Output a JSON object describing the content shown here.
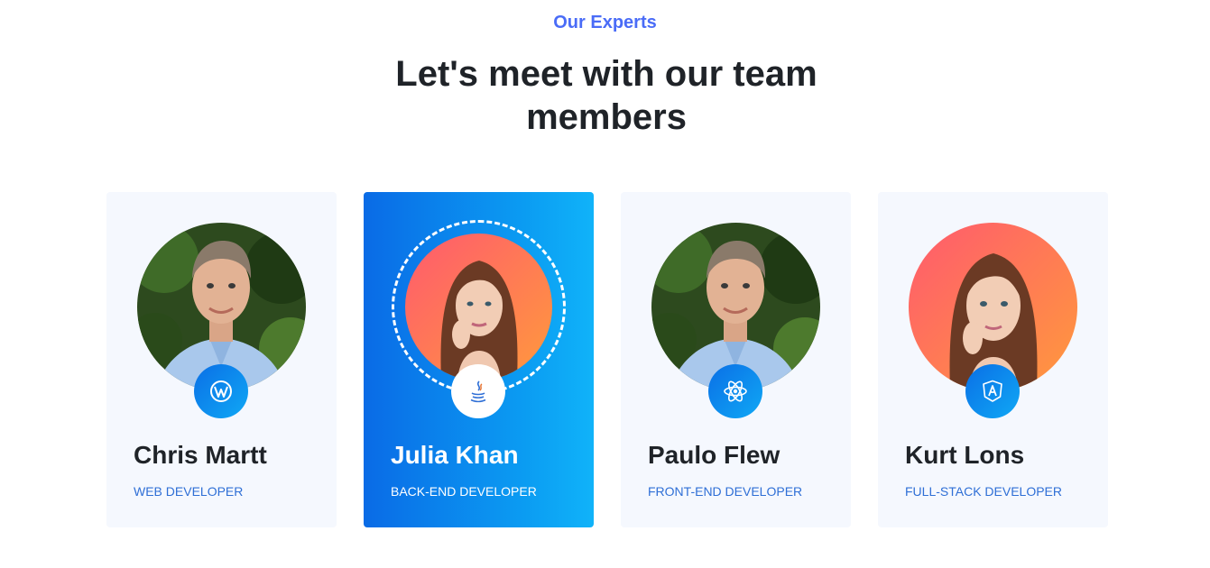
{
  "section": {
    "eyebrow": "Our Experts",
    "title": "Let's meet with our team members"
  },
  "members": [
    {
      "name": "Chris Martt",
      "role": "WEB DEVELOPER",
      "icon": "wordpress-icon",
      "active": false
    },
    {
      "name": "Julia Khan",
      "role": "BACK-END DEVELOPER",
      "icon": "java-icon",
      "active": true
    },
    {
      "name": "Paulo Flew",
      "role": "FRONT-END DEVELOPER",
      "icon": "react-icon",
      "active": false
    },
    {
      "name": "Kurt Lons",
      "role": "FULL-STACK DEVELOPER",
      "icon": "angular-icon",
      "active": false
    }
  ],
  "colors": {
    "accent": "#4a6cf7",
    "active_card_gradient": [
      "#0a6be6",
      "#10b3f9"
    ],
    "card_background": "#f5f8fe",
    "role_text": "#2f6fd6",
    "heading_text": "#1f2328"
  }
}
